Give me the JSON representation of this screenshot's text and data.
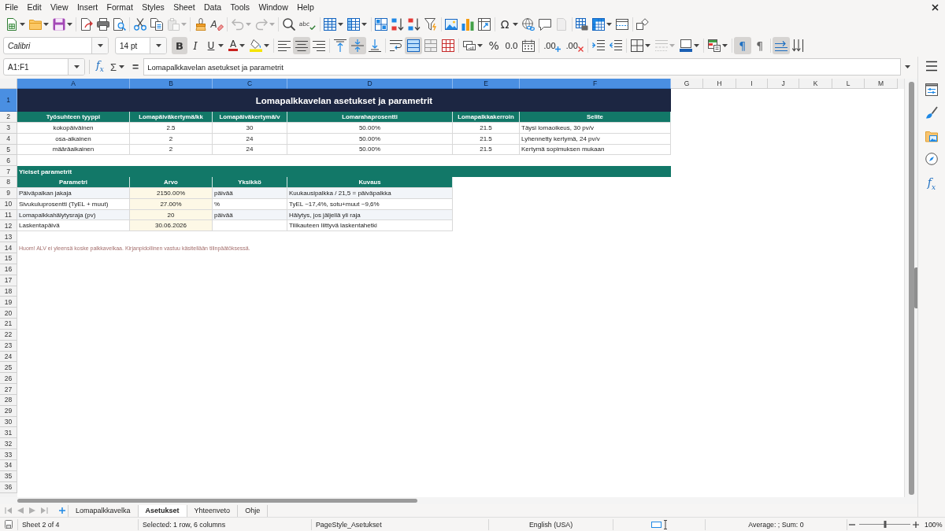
{
  "menu_bar": {
    "items": [
      "File",
      "Edit",
      "View",
      "Insert",
      "Format",
      "Styles",
      "Sheet",
      "Data",
      "Tools",
      "Window",
      "Help"
    ]
  },
  "standard_toolbar": {
    "groups": [
      [
        {
          "kind": "new",
          "dropdown": true,
          "disabled": false
        },
        {
          "kind": "open",
          "dropdown": true,
          "disabled": false
        },
        {
          "kind": "save",
          "dropdown": true,
          "disabled": false
        }
      ],
      [
        {
          "kind": "export_pdf",
          "dropdown": false,
          "disabled": false
        },
        {
          "kind": "print",
          "dropdown": false,
          "disabled": false
        },
        {
          "kind": "print_preview",
          "dropdown": false,
          "disabled": false
        }
      ],
      [
        {
          "kind": "cut",
          "dropdown": false,
          "disabled": false
        },
        {
          "kind": "copy",
          "dropdown": false,
          "disabled": false
        },
        {
          "kind": "paste",
          "dropdown": true,
          "disabled": true
        }
      ],
      [
        {
          "kind": "clone_formatting",
          "dropdown": false,
          "disabled": false
        },
        {
          "kind": "clear_formatting",
          "glyph": "A",
          "dropdown": false,
          "disabled": false
        }
      ],
      [
        {
          "kind": "undo",
          "dropdown": true,
          "disabled": true
        },
        {
          "kind": "redo",
          "dropdown": true,
          "disabled": true
        }
      ],
      [
        {
          "kind": "find_replace",
          "dropdown": false,
          "disabled": false
        },
        {
          "kind": "spelling",
          "glyph": "abc",
          "dropdown": false,
          "disabled": false
        }
      ],
      [
        {
          "kind": "rows",
          "dropdown": true,
          "disabled": false
        },
        {
          "kind": "columns",
          "dropdown": true,
          "disabled": false
        }
      ],
      [
        {
          "kind": "sort",
          "dropdown": false,
          "disabled": false
        },
        {
          "kind": "sort_ascending",
          "dropdown": false,
          "disabled": false
        },
        {
          "kind": "sort_descending",
          "dropdown": false,
          "disabled": false
        },
        {
          "kind": "autofilter",
          "dropdown": false,
          "disabled": false
        }
      ],
      [
        {
          "kind": "image",
          "dropdown": false,
          "disabled": false
        },
        {
          "kind": "chart",
          "dropdown": false,
          "disabled": false
        },
        {
          "kind": "pivot_table",
          "dropdown": false,
          "disabled": false
        }
      ],
      [
        {
          "kind": "special_character",
          "glyph": "Ω",
          "dropdown": true,
          "disabled": false
        },
        {
          "kind": "hyperlink",
          "dropdown": false,
          "disabled": false
        },
        {
          "kind": "comment",
          "dropdown": false,
          "disabled": false
        },
        {
          "kind": "header_footer",
          "dropdown": false,
          "disabled": true
        }
      ],
      [
        {
          "kind": "print_area",
          "dropdown": false,
          "disabled": false
        },
        {
          "kind": "freeze",
          "dropdown": true,
          "disabled": false
        },
        {
          "kind": "split_window",
          "dropdown": false,
          "disabled": false
        }
      ],
      [
        {
          "kind": "shapes",
          "dropdown": false,
          "disabled": false
        }
      ]
    ]
  },
  "formatting_toolbar": {
    "font_name": "Calibri",
    "font_size": "14 pt",
    "groups": [
      [
        {
          "kind": "bold",
          "glyph": "B",
          "dropdown": false,
          "on": true,
          "disabled": false
        },
        {
          "kind": "italic",
          "glyph": "I",
          "dropdown": false,
          "on": false,
          "disabled": false
        },
        {
          "kind": "underline",
          "glyph": "U",
          "dropdown": true,
          "on": false,
          "disabled": false
        },
        {
          "kind": "font_color",
          "glyph": "A",
          "dropdown": true,
          "on": false,
          "disabled": false
        },
        {
          "kind": "highlight",
          "dropdown": true,
          "on": false,
          "disabled": false
        }
      ],
      [
        {
          "kind": "align_left",
          "dropdown": false,
          "on": false,
          "disabled": false
        },
        {
          "kind": "align_center",
          "dropdown": false,
          "on": true,
          "disabled": false
        },
        {
          "kind": "align_right",
          "dropdown": false,
          "on": false,
          "disabled": false
        }
      ],
      [
        {
          "kind": "align_top",
          "dropdown": false,
          "on": false,
          "disabled": false
        },
        {
          "kind": "align_middle",
          "dropdown": false,
          "on": true,
          "disabled": false
        },
        {
          "kind": "align_bottom",
          "dropdown": false,
          "on": false,
          "disabled": false
        }
      ],
      [
        {
          "kind": "wrap_text",
          "dropdown": false,
          "on": false,
          "disabled": false
        },
        {
          "kind": "merge_center",
          "dropdown": false,
          "on": true,
          "disabled": false
        },
        {
          "kind": "merge_cells",
          "dropdown": false,
          "on": false,
          "disabled": false
        },
        {
          "kind": "unmerge_cells",
          "dropdown": false,
          "on": false,
          "disabled": false
        }
      ],
      [
        {
          "kind": "currency",
          "dropdown": true,
          "on": false,
          "disabled": false
        },
        {
          "kind": "percent",
          "glyph": "%",
          "dropdown": false,
          "on": false,
          "disabled": false
        },
        {
          "kind": "number",
          "glyph": "0.0",
          "dropdown": false,
          "on": false,
          "disabled": false
        },
        {
          "kind": "date",
          "dropdown": false,
          "on": false,
          "disabled": false
        }
      ],
      [
        {
          "kind": "add_decimal",
          "glyph": ".00",
          "dropdown": false,
          "on": false,
          "disabled": false
        },
        {
          "kind": "delete_decimal",
          "glyph": ".00",
          "dropdown": false,
          "on": false,
          "disabled": false
        }
      ],
      [
        {
          "kind": "indent_increase",
          "dropdown": false,
          "on": false,
          "disabled": false
        },
        {
          "kind": "indent_decrease",
          "dropdown": false,
          "on": false,
          "disabled": false
        }
      ],
      [
        {
          "kind": "borders",
          "dropdown": true,
          "on": false,
          "disabled": false
        },
        {
          "kind": "border_style",
          "dropdown": true,
          "on": false,
          "disabled": true
        },
        {
          "kind": "border_color",
          "dropdown": true,
          "on": false,
          "disabled": false
        }
      ],
      [
        {
          "kind": "conditional",
          "dropdown": true,
          "on": false,
          "disabled": false
        }
      ],
      [
        {
          "kind": "left_to_right",
          "glyph": "¶",
          "dropdown": false,
          "on": true,
          "disabled": false
        },
        {
          "kind": "right_to_left",
          "glyph": "¶",
          "dropdown": false,
          "on": false,
          "disabled": false
        }
      ],
      [
        {
          "kind": "text_left_to_right",
          "dropdown": false,
          "on": true,
          "disabled": false
        },
        {
          "kind": "text_top_to_bottom",
          "dropdown": false,
          "on": false,
          "disabled": false
        }
      ]
    ]
  },
  "formula_bar": {
    "name_box": "A1:F1",
    "function_wizard": "f$_{x}$",
    "sum": "Σ",
    "equals": "=",
    "content": "Lomapalkkavelan asetukset ja parametrit"
  },
  "sheet": {
    "columns": [
      {
        "label": "A",
        "selected": true
      },
      {
        "label": "B",
        "selected": true
      },
      {
        "label": "C",
        "selected": true
      },
      {
        "label": "D",
        "selected": true
      },
      {
        "label": "E",
        "selected": true
      },
      {
        "label": "F",
        "selected": true
      },
      {
        "label": "G",
        "selected": false
      },
      {
        "label": "H",
        "selected": false
      },
      {
        "label": "I",
        "selected": false
      },
      {
        "label": "J",
        "selected": false
      },
      {
        "label": "K",
        "selected": false
      },
      {
        "label": "L",
        "selected": false
      },
      {
        "label": "M",
        "selected": false
      }
    ],
    "rows": [
      {
        "label": "1",
        "selected": true
      },
      {
        "label": "2",
        "selected": false
      },
      {
        "label": "3",
        "selected": false
      },
      {
        "label": "4",
        "selected": false
      },
      {
        "label": "5",
        "selected": false
      },
      {
        "label": "6",
        "selected": false
      },
      {
        "label": "7",
        "selected": false
      },
      {
        "label": "8",
        "selected": false
      },
      {
        "label": "9",
        "selected": false
      },
      {
        "label": "10",
        "selected": false
      },
      {
        "label": "11",
        "selected": false
      },
      {
        "label": "12",
        "selected": false
      },
      {
        "label": "13",
        "selected": false
      },
      {
        "label": "14",
        "selected": false
      },
      {
        "label": "15",
        "selected": false
      },
      {
        "label": "16",
        "selected": false
      },
      {
        "label": "17",
        "selected": false
      },
      {
        "label": "18",
        "selected": false
      },
      {
        "label": "19",
        "selected": false
      },
      {
        "label": "20",
        "selected": false
      },
      {
        "label": "21",
        "selected": false
      },
      {
        "label": "22",
        "selected": false
      },
      {
        "label": "23",
        "selected": false
      },
      {
        "label": "24",
        "selected": false
      },
      {
        "label": "25",
        "selected": false
      },
      {
        "label": "26",
        "selected": false
      },
      {
        "label": "27",
        "selected": false
      },
      {
        "label": "28",
        "selected": false
      },
      {
        "label": "29",
        "selected": false
      },
      {
        "label": "30",
        "selected": false
      },
      {
        "label": "31",
        "selected": false
      },
      {
        "label": "32",
        "selected": false
      },
      {
        "label": "33",
        "selected": false
      },
      {
        "label": "34",
        "selected": false
      },
      {
        "label": "35",
        "selected": false
      },
      {
        "label": "36",
        "selected": false
      }
    ],
    "title": "Lomapalkkavelan asetukset ja parametrit",
    "accrual_table": {
      "columns": [
        "Työsuhteen tyyppi",
        "Lomapäiväkertymä/kk",
        "Lomapäiväkertymä/v",
        "Lomarahaprosentti",
        "Lomapalkkakerroin",
        "Selite"
      ],
      "rows": [
        {
          "type": "kokopäiväinen",
          "per_month": "2.5",
          "per_year": "30",
          "holiday_bonus": "50.00%",
          "multiplier": "21.5",
          "description": "Täysi lomaoikeus, 30 pv/v"
        },
        {
          "type": "osa-aikainen",
          "per_month": "2",
          "per_year": "24",
          "holiday_bonus": "50.00%",
          "multiplier": "21.5",
          "description": "Lyhennetty kertymä, 24 pv/v"
        },
        {
          "type": "määräaikainen",
          "per_month": "2",
          "per_year": "24",
          "holiday_bonus": "50.00%",
          "multiplier": "21.5",
          "description": "Kertymä sopimuksen mukaan"
        }
      ]
    },
    "general_parameters": {
      "title": "Yleiset parametrit",
      "columns": [
        "Parametri",
        "Arvo",
        "Yksikkö",
        "Kuvaus"
      ],
      "rows": [
        {
          "name": "Päiväpalkan jakaja",
          "value": "2150.00%",
          "unit": "päivää",
          "description": "Kuukausipalkka / 21,5 = päiväpalkka"
        },
        {
          "name": "Sivukuluprosentti (TyEL + muut)",
          "value": "27.00%",
          "unit": "%",
          "description": "TyEL ~17,4%, sotu+muut ~9,6%"
        },
        {
          "name": "Lomapalkkahälytysraja (pv)",
          "value": "20",
          "unit": "päivää",
          "description": "Hälytys, jos jäljellä yli raja"
        },
        {
          "name": "Laskentapäivä",
          "value": "30.06.2026",
          "description": "Tilikauteen liittyvä laskentahetki"
        }
      ]
    },
    "note": "Huom! ALV ei yleensä koske palkkavelkaa. Kirjanpidollinen vastuu käsitellään tilinpäätöksessä."
  },
  "sheet_tabs": {
    "tabs": [
      {
        "label": "Lomapalkkavelka",
        "selected": false
      },
      {
        "label": "Asetukset",
        "selected": true
      },
      {
        "label": "Yhteenveto",
        "selected": false
      },
      {
        "label": "Ohje",
        "selected": false
      }
    ]
  },
  "sidebar": {
    "functions": "f$_{x}$"
  },
  "status_bar": {
    "sheet": "Sheet 2 of 4",
    "selection": "Selected: 1 row, 6 columns",
    "page_style": "PageStyle_Asetukset",
    "language": "English (USA)",
    "summary": "Average: ; Sum: 0",
    "zoom": {
      "level": 0.5,
      "reading": "100%"
    }
  }
}
